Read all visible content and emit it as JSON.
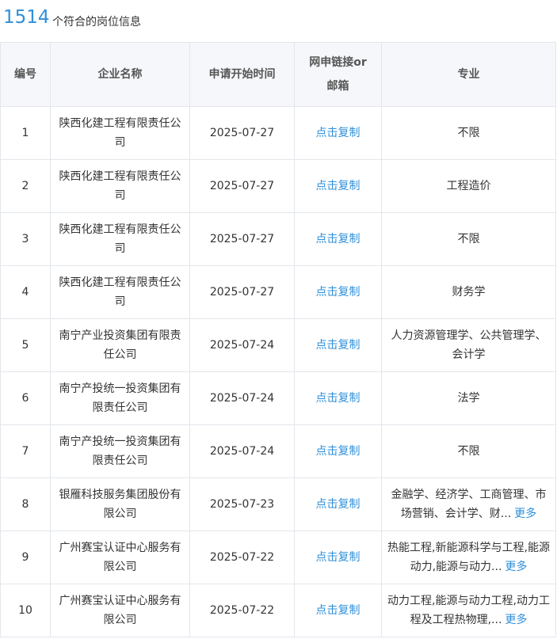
{
  "summary": {
    "count": "1514",
    "label": "个符合的岗位信息"
  },
  "table": {
    "headers": [
      "编号",
      "企业名称",
      "申请开始时间",
      "网申链接or邮箱",
      "专业"
    ],
    "link_label": "点击复制",
    "more_label": "更多",
    "rows": [
      {
        "no": "1",
        "company": "陕西化建工程有限责任公司",
        "date": "2025-07-27",
        "major": "不限",
        "more": false
      },
      {
        "no": "2",
        "company": "陕西化建工程有限责任公司",
        "date": "2025-07-27",
        "major": "工程造价",
        "more": false
      },
      {
        "no": "3",
        "company": "陕西化建工程有限责任公司",
        "date": "2025-07-27",
        "major": "不限",
        "more": false
      },
      {
        "no": "4",
        "company": "陕西化建工程有限责任公司",
        "date": "2025-07-27",
        "major": "财务学",
        "more": false
      },
      {
        "no": "5",
        "company": "南宁产业投资集团有限责任公司",
        "date": "2025-07-24",
        "major": "人力资源管理学、公共管理学、会计学",
        "more": false
      },
      {
        "no": "6",
        "company": "南宁产投统一投资集团有限责任公司",
        "date": "2025-07-24",
        "major": "法学",
        "more": false
      },
      {
        "no": "7",
        "company": "南宁产投统一投资集团有限责任公司",
        "date": "2025-07-24",
        "major": "不限",
        "more": false
      },
      {
        "no": "8",
        "company": "银雁科技服务集团股份有限公司",
        "date": "2025-07-23",
        "major": "金融学、经济学、工商管理、市场营销、会计学、财...",
        "more": true
      },
      {
        "no": "9",
        "company": "广州赛宝认证中心服务有限公司",
        "date": "2025-07-22",
        "major": "热能工程,新能源科学与工程,能源动力,能源与动力...",
        "more": true
      },
      {
        "no": "10",
        "company": "广州赛宝认证中心服务有限公司",
        "date": "2025-07-22",
        "major": "动力工程,能源与动力工程,动力工程及工程热物理,...",
        "more": true
      }
    ]
  }
}
